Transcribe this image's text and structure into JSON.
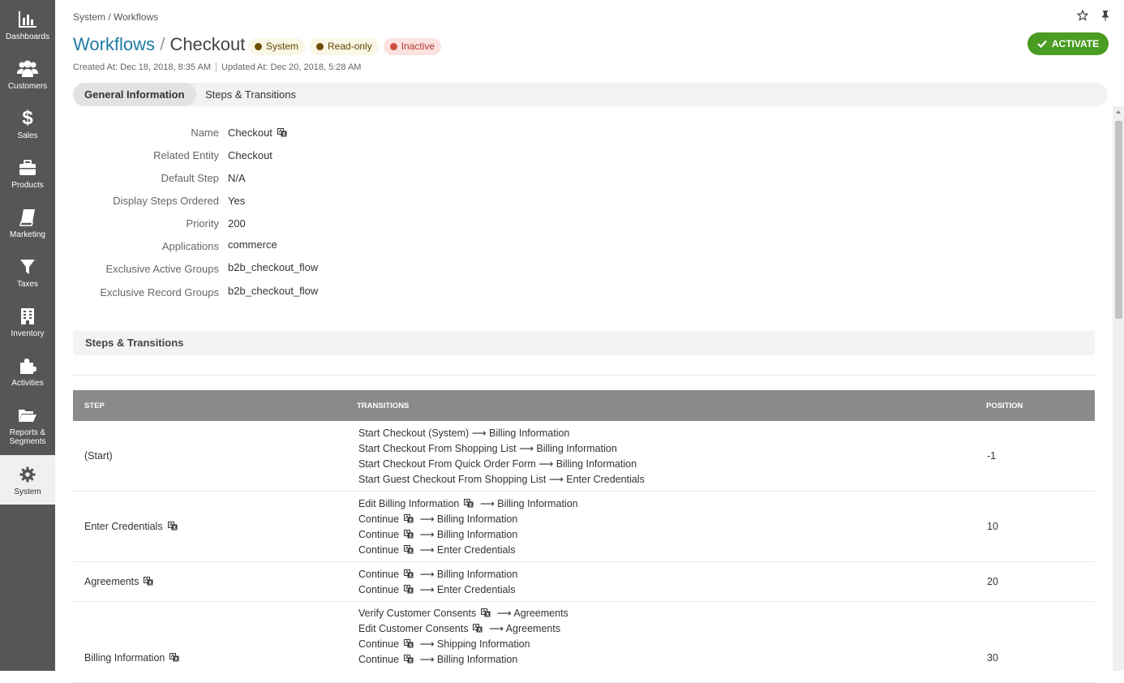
{
  "sidebar": {
    "items": [
      {
        "label": "Dashboards",
        "icon": "bar-chart-icon"
      },
      {
        "label": "Customers",
        "icon": "users-icon"
      },
      {
        "label": "Sales",
        "icon": "dollar-icon"
      },
      {
        "label": "Products",
        "icon": "briefcase-icon"
      },
      {
        "label": "Marketing",
        "icon": "book-icon"
      },
      {
        "label": "Taxes",
        "icon": "filter-icon"
      },
      {
        "label": "Inventory",
        "icon": "building-icon"
      },
      {
        "label": "Activities",
        "icon": "puzzle-icon"
      },
      {
        "label_line1": "Reports &",
        "label_line2": "Segments",
        "icon": "folder-open-icon"
      },
      {
        "label": "System",
        "icon": "gear-icon",
        "active": true
      }
    ]
  },
  "header": {
    "breadcrumb": "System / Workflows",
    "title_link": "Workflows",
    "title_sep": "/",
    "title_current": "Checkout",
    "badges": [
      "System",
      "Read-only",
      "Inactive"
    ],
    "created": "Created At: Dec 18, 2018, 8:35 AM",
    "updated": "Updated At: Dec 20, 2018, 5:28 AM",
    "activate_label": "ACTIVATE"
  },
  "tabs": [
    "General Information",
    "Steps & Transitions"
  ],
  "general": {
    "rows": [
      {
        "key": "Name",
        "value": "Checkout",
        "translate": true
      },
      {
        "key": "Related Entity",
        "value": "Checkout"
      },
      {
        "key": "Default Step",
        "value": "N/A"
      },
      {
        "key": "Display Steps Ordered",
        "value": "Yes"
      },
      {
        "key": "Priority",
        "value": "200"
      },
      {
        "key": "Applications",
        "value": "commerce"
      },
      {
        "key": "Exclusive Active Groups",
        "value": "b2b_checkout_flow"
      },
      {
        "key": "Exclusive Record Groups",
        "value": "b2b_checkout_flow"
      }
    ]
  },
  "steps": {
    "section_title": "Steps & Transitions",
    "columns": [
      "STEP",
      "TRANSITIONS",
      "POSITION"
    ],
    "arrow": "⟶",
    "rows": [
      {
        "step": "(Start)",
        "position": "-1",
        "transitions": [
          {
            "name": "Start Checkout (System)",
            "target": "Billing Information"
          },
          {
            "name": "Start Checkout From Shopping List",
            "target": "Billing Information"
          },
          {
            "name": "Start Checkout From Quick Order Form",
            "target": "Billing Information"
          },
          {
            "name": "Start Guest Checkout From Shopping List",
            "target": "Enter Credentials"
          }
        ]
      },
      {
        "step": "Enter Credentials",
        "position": "10",
        "translate": true,
        "transitions": [
          {
            "name": "Edit Billing Information",
            "target": "Billing Information",
            "translate": true
          },
          {
            "name": "Continue",
            "target": "Billing Information",
            "translate": true
          },
          {
            "name": "Continue",
            "target": "Billing Information",
            "translate": true
          },
          {
            "name": "Continue",
            "target": "Enter Credentials",
            "translate": true
          }
        ]
      },
      {
        "step": "Agreements",
        "position": "20",
        "translate": true,
        "transitions": [
          {
            "name": "Continue",
            "target": "Billing Information",
            "translate": true
          },
          {
            "name": "Continue",
            "target": "Enter Credentials",
            "translate": true
          }
        ]
      },
      {
        "step": "Billing Information",
        "position": "30",
        "translate": true,
        "transitions": [
          {
            "name": "Verify Customer Consents",
            "target": "Agreements",
            "translate": true
          },
          {
            "name": "Edit Customer Consents",
            "target": "Agreements",
            "translate": true
          },
          {
            "name": "Continue",
            "target": "Shipping Information",
            "translate": true
          },
          {
            "name": "Continue",
            "target": "Billing Information",
            "translate": true
          }
        ]
      }
    ]
  },
  "colors": {
    "sidebar": "#565656",
    "link": "#1f7aa3",
    "activate": "#4a9c22",
    "table_header": "#8a8a8a"
  }
}
